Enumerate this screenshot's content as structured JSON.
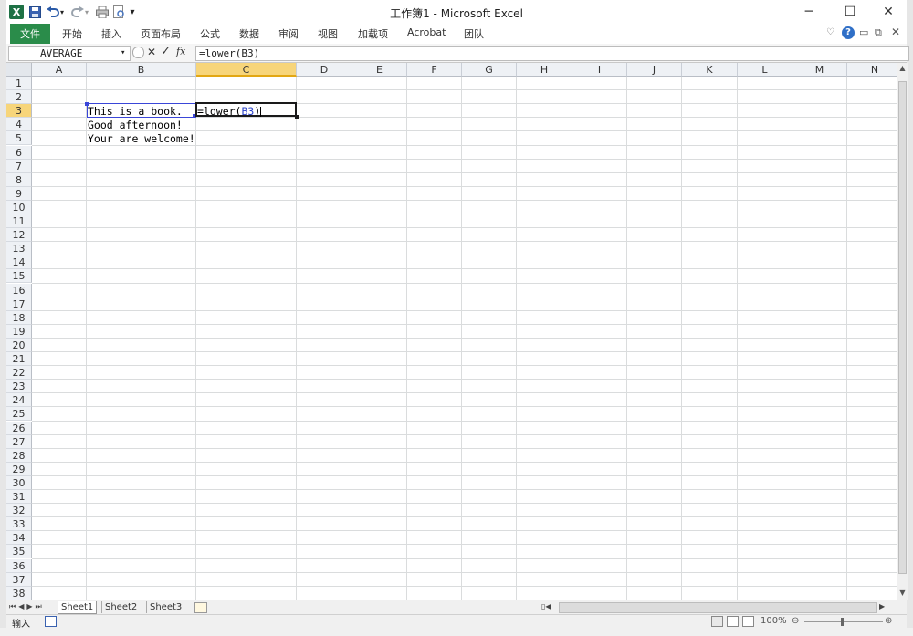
{
  "window": {
    "title": "工作簿1 - Microsoft Excel",
    "app_icon": "X",
    "minimize": "─",
    "maximize": "☐",
    "close": "✕"
  },
  "ribbon": {
    "file_tab": "文件",
    "tabs": [
      "开始",
      "插入",
      "页面布局",
      "公式",
      "数据",
      "审阅",
      "视图",
      "加载项",
      "Acrobat",
      "团队"
    ]
  },
  "formula_bar": {
    "name_box": "AVERAGE",
    "cancel_symbol": "✕",
    "enter_symbol": "✓",
    "fx_label": "fx",
    "formula": "=lower(B3)"
  },
  "grid": {
    "columns": [
      "A",
      "B",
      "C",
      "D",
      "E",
      "F",
      "G",
      "H",
      "I",
      "J",
      "K",
      "L",
      "M",
      "N"
    ],
    "active_column": "C",
    "active_row": 3,
    "row_count": 38,
    "cells": {
      "B3": "This is a book.",
      "B4": "Good afternoon!",
      "B5": "Your are welcome!",
      "C3_prefix": "=lower(",
      "C3_ref": "B3",
      "C3_suffix": ")"
    }
  },
  "sheets": {
    "tabs": [
      "Sheet1",
      "Sheet2",
      "Sheet3"
    ],
    "active": "Sheet1"
  },
  "status_bar": {
    "mode": "输入",
    "zoom": "100%"
  },
  "colors": {
    "file_tab": "#2a8c4a",
    "active_header": "#f7d57a",
    "formula_ref": "#2b43c9"
  }
}
